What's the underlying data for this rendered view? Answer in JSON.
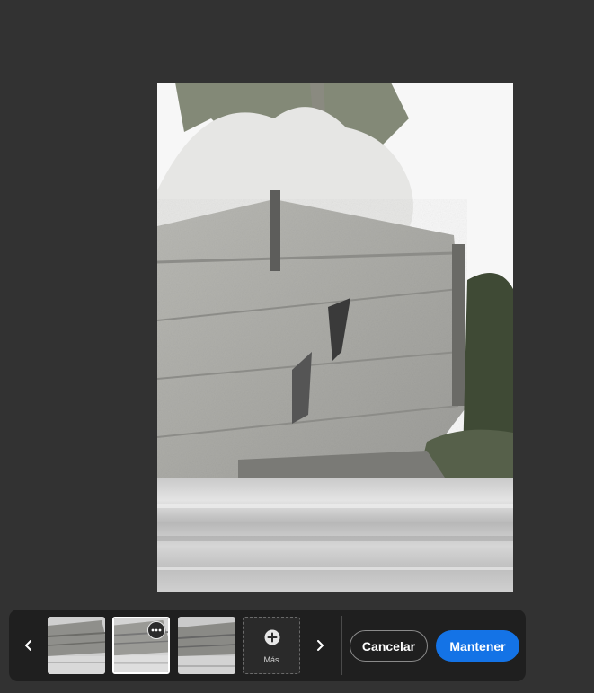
{
  "filmstrip": {
    "prev_icon": "chevron-left-icon",
    "next_icon": "chevron-right-icon",
    "selected_index": 1,
    "thumbnail_count": 3,
    "more_label": "Más",
    "more_icon": "plus-circle-icon",
    "options_icon": "more-horizontal-icon"
  },
  "actions": {
    "cancel_label": "Cancelar",
    "keep_label": "Mantener"
  },
  "colors": {
    "background": "#323232",
    "toolbar": "#1f1f1f",
    "primary_button": "#1473e6"
  }
}
